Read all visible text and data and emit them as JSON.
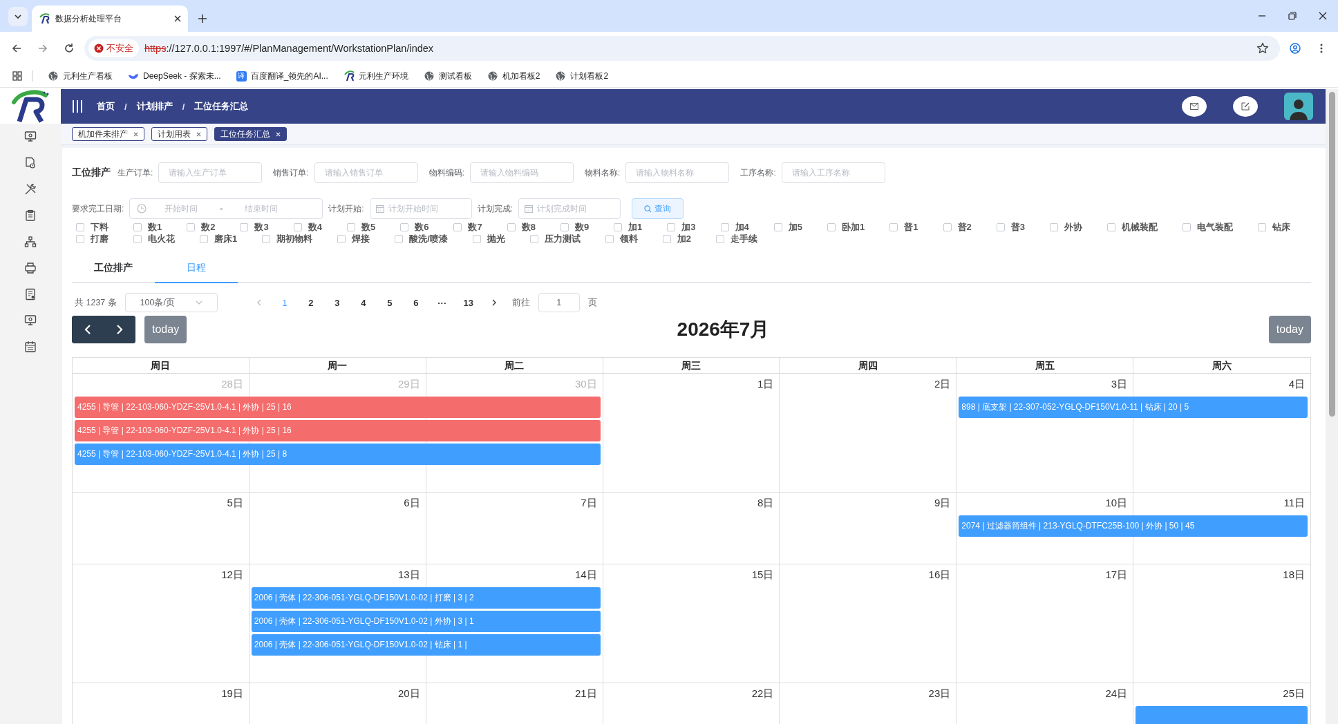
{
  "browser": {
    "tab_title": "数据分析处理平台",
    "security": "不安全",
    "url_scheme": "https",
    "url_rest": "://127.0.0.1:1997/#/PlanManagement/WorkstationPlan/index",
    "bookmarks": [
      {
        "label": "元利生产看板"
      },
      {
        "label": "DeepSeek - 探索未..."
      },
      {
        "label": "百度翻译_领先的AI...",
        "icon_text": "译"
      },
      {
        "label": "元利生产环境"
      },
      {
        "label": "测试看板"
      },
      {
        "label": "机加看板2"
      },
      {
        "label": "计划看板2"
      }
    ]
  },
  "breadcrumb": {
    "separator": "/",
    "items": [
      "首页",
      "计划排产",
      "工位任务汇总"
    ]
  },
  "tags": [
    {
      "label": "机加件未排产",
      "selected": false
    },
    {
      "label": "计划用表",
      "selected": false
    },
    {
      "label": "工位任务汇总",
      "selected": true
    }
  ],
  "filters": {
    "title": "工位排产",
    "fields": [
      {
        "label": "生产订单:",
        "placeholder": "请输入生产订单"
      },
      {
        "label": "销售订单:",
        "placeholder": "请输入销售订单"
      },
      {
        "label": "物料编码:",
        "placeholder": "请输入物料编码"
      },
      {
        "label": "物料名称:",
        "placeholder": "请输入物料名称"
      },
      {
        "label": "工序名称:",
        "placeholder": "请输入工序名称"
      }
    ],
    "date_range": {
      "label": "要求完工日期:",
      "start_placeholder": "开始时间",
      "separator": "-",
      "end_placeholder": "结束时间"
    },
    "date_fields": [
      {
        "label": "计划开始:",
        "placeholder": "计划开始时间"
      },
      {
        "label": "计划完成:",
        "placeholder": "计划完成时间"
      }
    ],
    "search_button": "查询",
    "processes": [
      {
        "label": "下料",
        "checked": false
      },
      {
        "label": "数1",
        "checked": false
      },
      {
        "label": "数2",
        "checked": false
      },
      {
        "label": "数3",
        "checked": false
      },
      {
        "label": "数4",
        "checked": false
      },
      {
        "label": "数5",
        "checked": false
      },
      {
        "label": "数6",
        "checked": false
      },
      {
        "label": "数7",
        "checked": false
      },
      {
        "label": "数8",
        "checked": false
      },
      {
        "label": "数9",
        "checked": false
      },
      {
        "label": "加1",
        "checked": false
      },
      {
        "label": "加3",
        "checked": false
      },
      {
        "label": "加4",
        "checked": false
      },
      {
        "label": "加5",
        "checked": false
      },
      {
        "label": "卧加1",
        "checked": false
      },
      {
        "label": "普1",
        "checked": false
      },
      {
        "label": "普2",
        "checked": false
      },
      {
        "label": "普3",
        "checked": false
      },
      {
        "label": "外协",
        "checked": false
      },
      {
        "label": "机械装配",
        "checked": false
      },
      {
        "label": "电气装配",
        "checked": false
      },
      {
        "label": "钻床",
        "checked": false
      },
      {
        "label": "打磨",
        "checked": false
      },
      {
        "label": "电火花",
        "checked": false
      },
      {
        "label": "磨床1",
        "checked": false
      },
      {
        "label": "期初物料",
        "checked": false
      },
      {
        "label": "焊接",
        "checked": false
      },
      {
        "label": "酸洗/喷漆",
        "checked": false
      },
      {
        "label": "抛光",
        "checked": false
      },
      {
        "label": "压力测试",
        "checked": false
      },
      {
        "label": "领料",
        "checked": false
      },
      {
        "label": "加2",
        "checked": false
      },
      {
        "label": "走手续",
        "checked": false
      }
    ]
  },
  "view_tabs": [
    {
      "label": "工位排产",
      "selected": false
    },
    {
      "label": "日程",
      "selected": true
    }
  ],
  "pagination": {
    "total": "共 1237 条",
    "page_size": "100条/页",
    "pages": [
      {
        "label": "1",
        "selected": true
      },
      {
        "label": "2",
        "selected": false
      },
      {
        "label": "3",
        "selected": false
      },
      {
        "label": "4",
        "selected": false
      },
      {
        "label": "5",
        "selected": false
      },
      {
        "label": "6",
        "selected": false
      },
      {
        "label": "···",
        "selected": false
      },
      {
        "label": "13",
        "selected": false
      }
    ],
    "goto_label": "前往",
    "goto_value": "1",
    "goto_suffix": "页"
  },
  "calendar": {
    "today_left": "today",
    "title": "2026年7月",
    "today_right": "today",
    "weekdays": [
      "周日",
      "周一",
      "周二",
      "周三",
      "周四",
      "周五",
      "周六"
    ],
    "weeks": [
      {
        "days": [
          {
            "label": "28日",
            "other_month": true
          },
          {
            "label": "29日",
            "other_month": true
          },
          {
            "label": "30日",
            "other_month": true
          },
          {
            "label": "1日",
            "other_month": false
          },
          {
            "label": "2日",
            "other_month": false
          },
          {
            "label": "3日",
            "other_month": false
          },
          {
            "label": "4日",
            "other_month": false
          }
        ],
        "events": [
          {
            "text": "4255 | 导管 | 22-103-060-YDZF-25V1.0-4.1 | 外协 | 25 | 16",
            "color": "#f56c6c"
          },
          {
            "text": "898 | 底支架 | 22-307-052-YGLQ-DF150V1.0-11 | 钻床 | 20 | 5",
            "color": "#409eff"
          },
          {
            "text": "4255 | 导管 | 22-103-060-YDZF-25V1.0-4.1 | 外协 | 25 | 16",
            "color": "#f56c6c"
          },
          {
            "text": "4255 | 导管 | 22-103-060-YDZF-25V1.0-4.1 | 外协 | 25 | 8",
            "color": "#409eff"
          }
        ]
      },
      {
        "days": [
          {
            "label": "5日",
            "other_month": false
          },
          {
            "label": "6日",
            "other_month": false
          },
          {
            "label": "7日",
            "other_month": false
          },
          {
            "label": "8日",
            "other_month": false
          },
          {
            "label": "9日",
            "other_month": false
          },
          {
            "label": "10日",
            "other_month": false
          },
          {
            "label": "11日",
            "other_month": false
          }
        ],
        "events": [
          {
            "text": "2074 | 过滤器筒组件 | 213-YGLQ-DTFC25B-100 | 外协 | 50 | 45",
            "color": "#409eff"
          }
        ]
      },
      {
        "days": [
          {
            "label": "12日",
            "other_month": false
          },
          {
            "label": "13日",
            "other_month": false
          },
          {
            "label": "14日",
            "other_month": false
          },
          {
            "label": "15日",
            "other_month": false
          },
          {
            "label": "16日",
            "other_month": false
          },
          {
            "label": "17日",
            "other_month": false
          },
          {
            "label": "18日",
            "other_month": false
          }
        ],
        "events": [
          {
            "text": "2006 | 壳体 | 22-306-051-YGLQ-DF150V1.0-02 | 打磨 | 3 | 2",
            "color": "#409eff"
          },
          {
            "text": "2006 | 壳体 | 22-306-051-YGLQ-DF150V1.0-02 | 外协 | 3 | 1",
            "color": "#409eff"
          },
          {
            "text": "2006 | 壳体 | 22-306-051-YGLQ-DF150V1.0-02 | 钻床 | 1 |",
            "color": "#409eff"
          }
        ]
      },
      {
        "days": [
          {
            "label": "19日",
            "other_month": false
          },
          {
            "label": "20日",
            "other_month": false
          },
          {
            "label": "21日",
            "other_month": false
          },
          {
            "label": "22日",
            "other_month": false
          },
          {
            "label": "23日",
            "other_month": false
          },
          {
            "label": "24日",
            "other_month": false
          },
          {
            "label": "25日",
            "other_month": false
          }
        ],
        "events": [
          {
            "color": "#409eff"
          }
        ]
      }
    ]
  }
}
